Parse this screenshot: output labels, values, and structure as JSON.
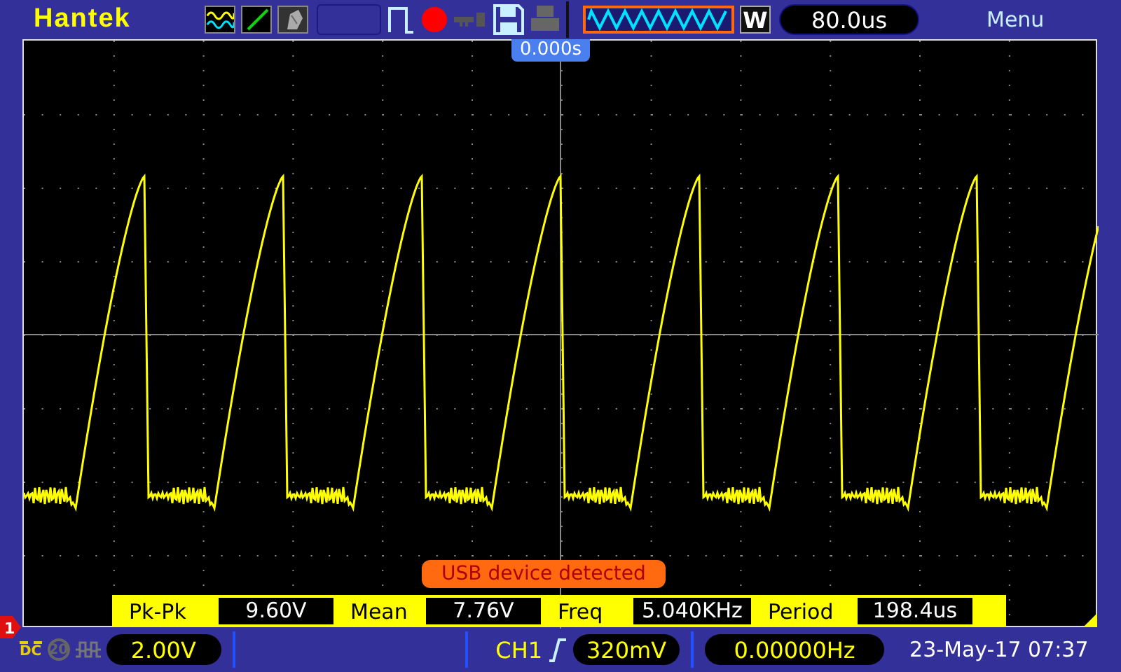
{
  "brand": "Hantek",
  "toolbar": {
    "pulse_trigger": true,
    "recording": true,
    "usb_key": false,
    "printer": false
  },
  "timebase_window": {
    "selected": true
  },
  "window_button": "W",
  "timebase": "80.0us",
  "menu": "Menu",
  "trigger_position": "0.000s",
  "toast": "USB device detected",
  "measurements": [
    {
      "label": "Pk-Pk",
      "value": "9.60V"
    },
    {
      "label": "Mean",
      "value": "7.76V"
    },
    {
      "label": "Freq",
      "value": "5.040KHz"
    },
    {
      "label": "Period",
      "value": "198.4us"
    }
  ],
  "channel": {
    "marker": "1",
    "coupling": "DC",
    "bw_limit": {
      "label": "20",
      "on": false
    },
    "volts": "2.00V"
  },
  "trigger": {
    "source": "CH1",
    "level": "320mV"
  },
  "frequency": "0.00000Hz",
  "datetime": "23-May-17 07:37"
}
